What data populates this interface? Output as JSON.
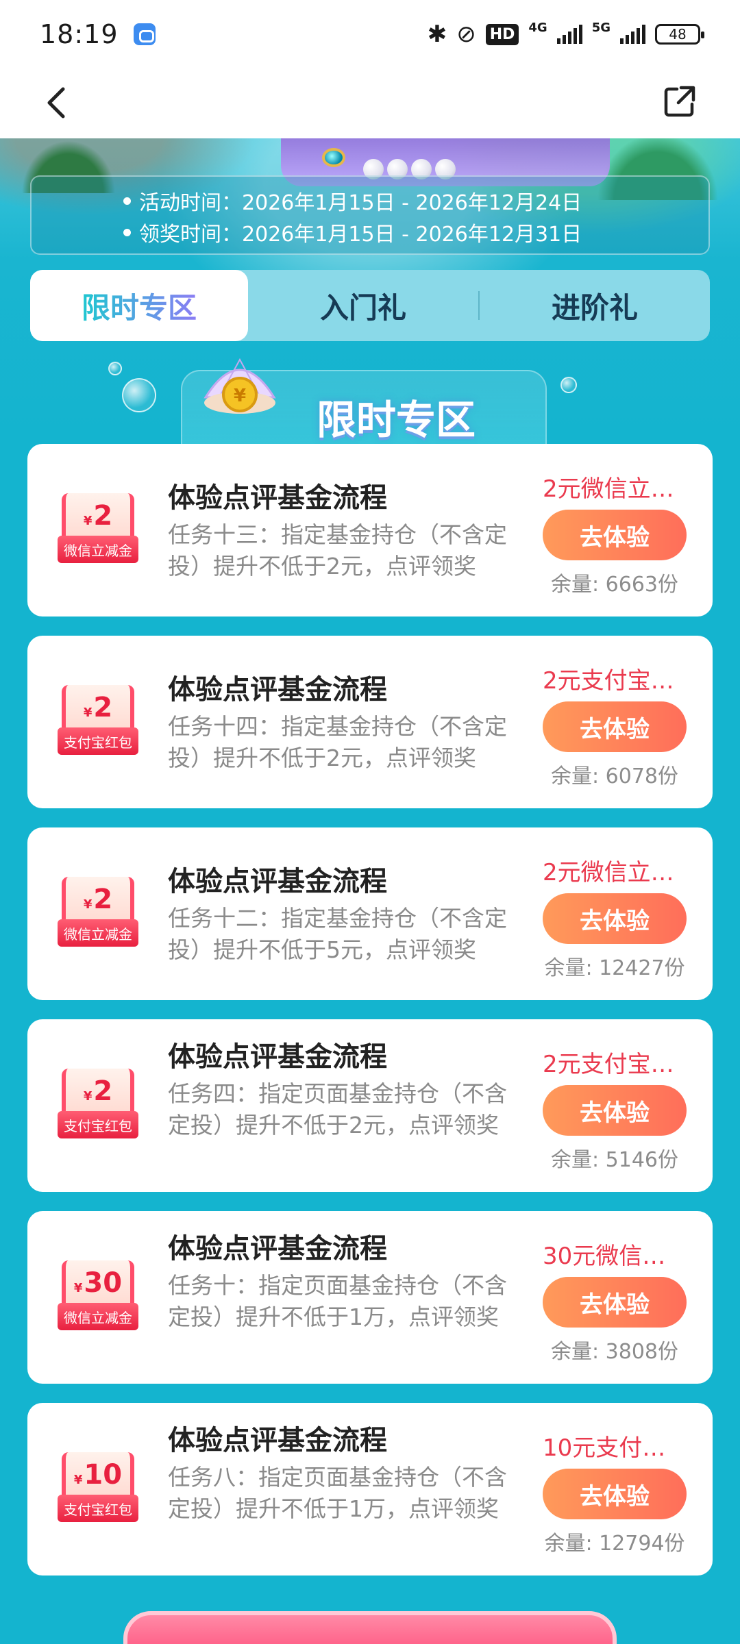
{
  "status_bar": {
    "time": "18:19",
    "hd_label": "HD",
    "net1": "4G",
    "net2": "5G",
    "battery": "48"
  },
  "nav": {
    "back_icon": "chevron-left-icon",
    "share_icon": "share-icon"
  },
  "activity": {
    "line1": "活动时间：2026年1月15日 - 2026年12月24日",
    "line2": "领奖时间：2026年1月15日 - 2026年12月31日"
  },
  "tabs": [
    {
      "label": "限时专区",
      "active": true
    },
    {
      "label": "入门礼",
      "active": false
    },
    {
      "label": "进阶礼",
      "active": false
    }
  ],
  "section_title": "限时专区",
  "tasks": [
    {
      "coupon_amount": "2",
      "coupon_label": "微信立减金",
      "title": "体验点评基金流程",
      "desc": "任务十三：指定基金持仓（不含定投）提升不低于2元，点评领奖",
      "reward": "2元微信立…",
      "button": "去体验",
      "stock": "余量: 6663份"
    },
    {
      "coupon_amount": "2",
      "coupon_label": "支付宝红包",
      "title": "体验点评基金流程",
      "desc": "任务十四：指定基金持仓（不含定投）提升不低于2元，点评领奖",
      "reward": "2元支付宝…",
      "button": "去体验",
      "stock": "余量: 6078份"
    },
    {
      "coupon_amount": "2",
      "coupon_label": "微信立减金",
      "title": "体验点评基金流程",
      "desc": "任务十二：指定基金持仓（不含定投）提升不低于5元，点评领奖",
      "reward": "2元微信立…",
      "button": "去体验",
      "stock": "余量: 12427份"
    },
    {
      "coupon_amount": "2",
      "coupon_label": "支付宝红包",
      "title": "体验点评基金流程",
      "desc": "任务四：指定页面基金持仓（不含定投）提升不低于2元，点评领奖",
      "reward": "2元支付宝…",
      "button": "去体验",
      "stock": "余量: 5146份"
    },
    {
      "coupon_amount": "30",
      "coupon_label": "微信立减金",
      "title": "体验点评基金流程",
      "desc": "任务十：指定页面基金持仓（不含定投）提升不低于1万，点评领奖",
      "reward": "30元微信…",
      "button": "去体验",
      "stock": "余量: 3808份"
    },
    {
      "coupon_amount": "10",
      "coupon_label": "支付宝红包",
      "title": "体验点评基金流程",
      "desc": "任务八：指定页面基金持仓（不含定投）提升不低于1万，点评领奖",
      "reward": "10元支付…",
      "button": "去体验",
      "stock": "余量: 12794份"
    }
  ],
  "colors": {
    "background": "#14b4cf",
    "accent_orange": "#ff7a5a",
    "reward_red": "#ea3a4e"
  }
}
